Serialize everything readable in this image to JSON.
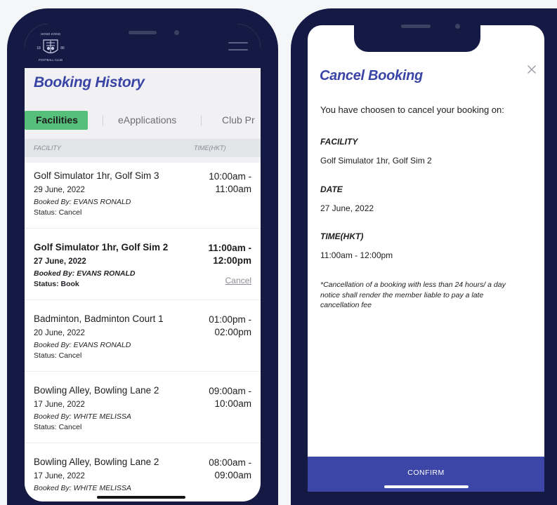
{
  "left_phone": {
    "logo": {
      "top_text": "HONG KONG",
      "year_left": "18",
      "year_right": "86",
      "bottom_text": "FOOTBALL CLUB"
    },
    "page_title": "Booking History",
    "tabs": [
      {
        "label": "Facilities",
        "active": true
      },
      {
        "label": "eApplications",
        "active": false
      },
      {
        "label": "Club Pr",
        "active": false
      }
    ],
    "columns": {
      "facility": "FACILITY",
      "time": "TIME(HKT)"
    },
    "bookings": [
      {
        "facility": "Golf Simulator 1hr, Golf Sim 3",
        "date": "29 June, 2022",
        "booked_by": "Booked By: EVANS RONALD",
        "status": "Status: Cancel",
        "time_start": "10:00am -",
        "time_end": "11:00am"
      },
      {
        "facility": "Golf Simulator 1hr, Golf Sim 2",
        "date": "27 June, 2022",
        "booked_by": "Booked By: EVANS RONALD",
        "status": "Status: Book",
        "time_start": "11:00am -",
        "time_end": "12:00pm",
        "action": "Cancel"
      },
      {
        "facility": "Badminton, Badminton Court 1",
        "date": "20 June, 2022",
        "booked_by": "Booked By: EVANS RONALD",
        "status": "Status: Cancel",
        "time_start": "01:00pm -",
        "time_end": "02:00pm"
      },
      {
        "facility": "Bowling Alley, Bowling Lane 2",
        "date": "17 June, 2022",
        "booked_by": "Booked By: WHITE MELISSA",
        "status": "Status: Cancel",
        "time_start": "09:00am -",
        "time_end": "10:00am"
      },
      {
        "facility": "Bowling Alley, Bowling Lane 2",
        "date": "17 June, 2022",
        "booked_by": "Booked By: WHITE MELISSA",
        "time_start": "08:00am -",
        "time_end": "09:00am"
      }
    ]
  },
  "right_phone": {
    "title": "Cancel Booking",
    "intro": "You have choosen to cancel your booking on:",
    "facility_label": "FACILITY",
    "facility_value": "Golf Simulator 1hr, Golf Sim 2",
    "date_label": "DATE",
    "date_value": "27 June, 2022",
    "time_label": "TIME(HKT)",
    "time_value": "11:00am - 12:00pm",
    "note_line1": "*Cancellation of a booking with less than 24 hours/ a day",
    "note_line2": "notice shall render the member liable to pay a late",
    "note_line3": "cancellation fee",
    "confirm_label": "CONFIRM",
    "close_icon": "close-icon"
  },
  "colors": {
    "navy": "#141a44",
    "accent_blue": "#3a44a6",
    "tab_green": "#56c07a",
    "confirm_blue": "#3b46a6"
  }
}
